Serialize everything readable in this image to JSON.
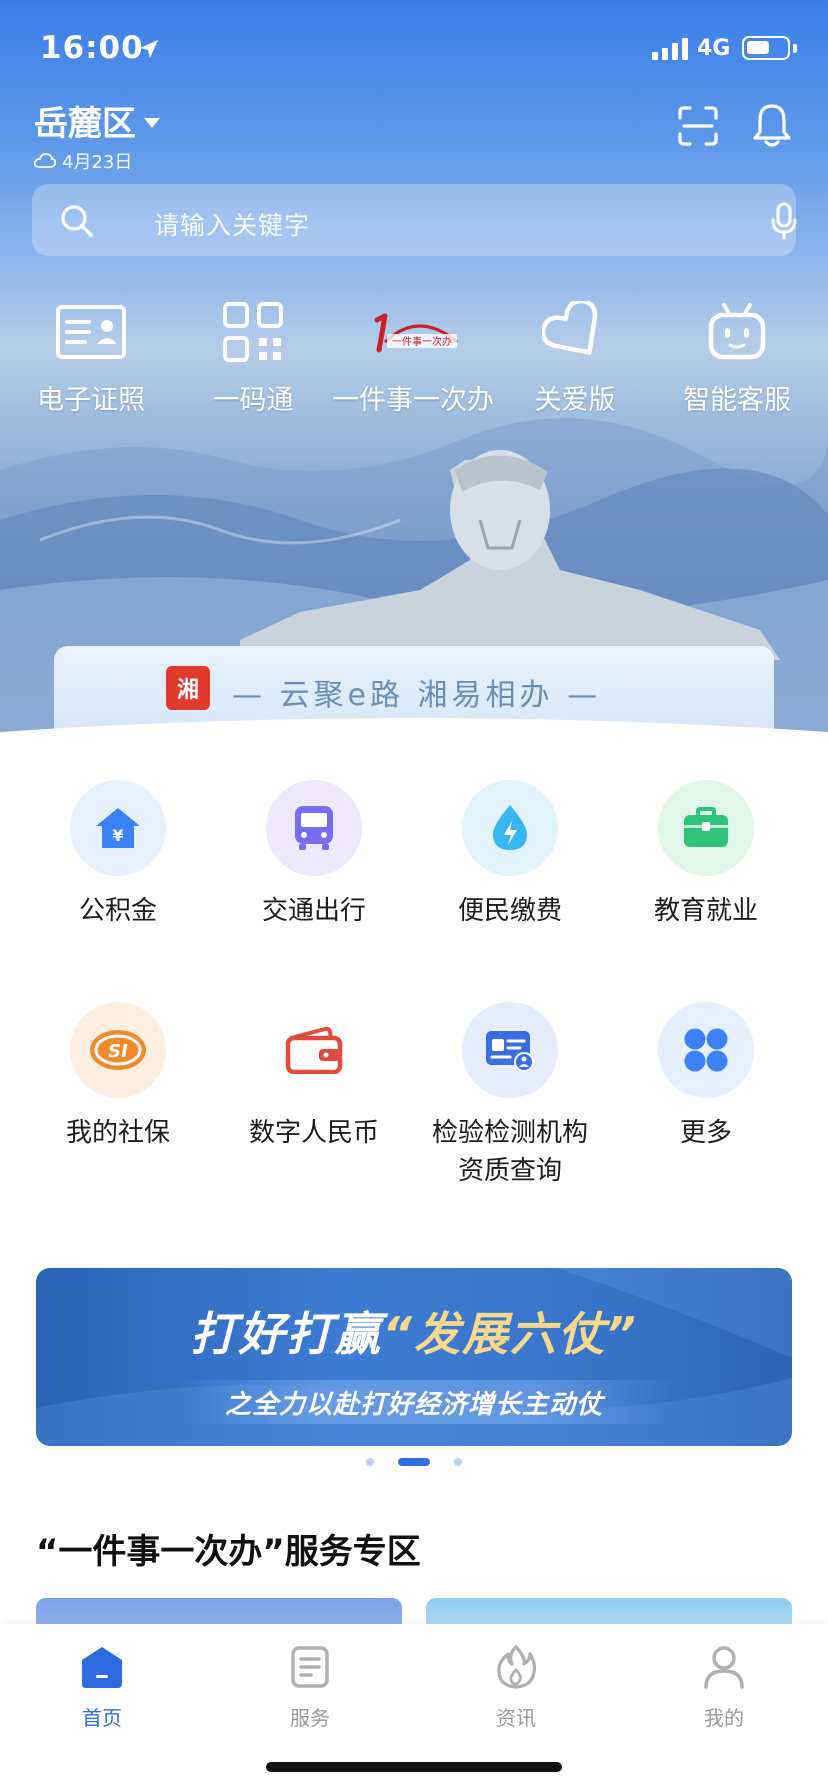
{
  "status_bar": {
    "time": "16:00",
    "network": "4G"
  },
  "header": {
    "region": "岳麓区",
    "date": "4月23日",
    "icons": [
      "scan-icon",
      "bell-icon"
    ]
  },
  "search": {
    "placeholder": "请输入关键字"
  },
  "quick_actions": [
    {
      "label": "电子证照",
      "icon": "id-card-icon"
    },
    {
      "label": "一码通",
      "icon": "qr-code-icon"
    },
    {
      "label": "一件事一次办",
      "icon": "one-thing-logo",
      "logo_text": "一件事一次办"
    },
    {
      "label": "关爱版",
      "icon": "heart-icon"
    },
    {
      "label": "智能客服",
      "icon": "robot-icon"
    }
  ],
  "slogan": {
    "logo_text": "湘",
    "text": "— 云聚e路 湘易相办 —"
  },
  "services": [
    {
      "label": "公积金",
      "icon": "house-fund-icon",
      "color": "#3b82f6"
    },
    {
      "label": "交通出行",
      "icon": "bus-icon",
      "color": "#7a6cf0"
    },
    {
      "label": "便民缴费",
      "icon": "water-drop-icon",
      "color": "#38b6f2"
    },
    {
      "label": "教育就业",
      "icon": "briefcase-icon",
      "color": "#2fc47a"
    },
    {
      "label": "我的社保",
      "icon": "social-security-icon",
      "color": "#f08a2a"
    },
    {
      "label": "数字人民币",
      "icon": "wallet-icon",
      "color": "#e24a3d"
    },
    {
      "label": "检验检测机构资质查询",
      "label_line1": "检验检测机构",
      "label_line2": "资质查询",
      "icon": "certificate-icon",
      "color": "#3a6fe0"
    },
    {
      "label": "更多",
      "icon": "grid-more-icon",
      "color": "#3b82f6"
    }
  ],
  "banner": {
    "title_prefix": "打好打赢",
    "title_highlight": "“发展六仗”",
    "subtitle": "之全力以赴打好经济增长主动仗"
  },
  "carousel": {
    "count": 3,
    "active": 2
  },
  "section": {
    "title": "“一件事一次办”服务专区"
  },
  "tabs": [
    {
      "label": "首页",
      "icon": "home-icon",
      "active": true
    },
    {
      "label": "服务",
      "icon": "document-icon",
      "active": false
    },
    {
      "label": "资讯",
      "icon": "flame-icon",
      "active": false
    },
    {
      "label": "我的",
      "icon": "user-icon",
      "active": false
    }
  ],
  "colors": {
    "accent": "#2c6be0",
    "hero_top": "#3a7fe8"
  }
}
